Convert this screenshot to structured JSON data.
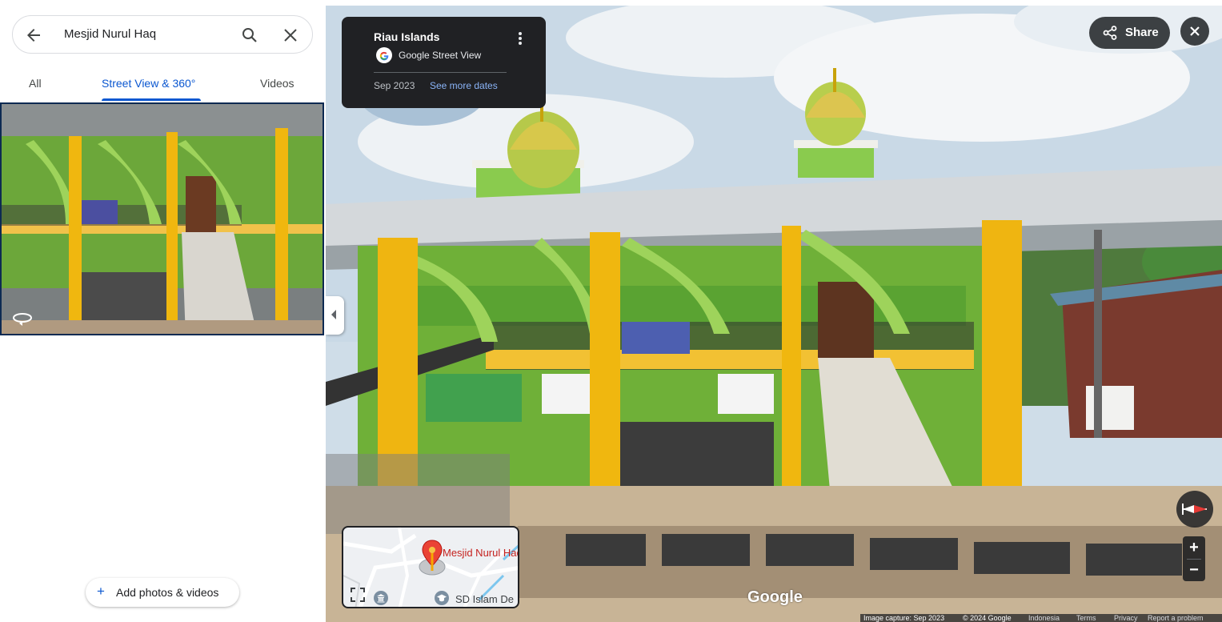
{
  "search": {
    "query": "Mesjid Nurul Haq"
  },
  "icons": {
    "back": "arrow-back-icon",
    "search": "search-icon",
    "clear": "close-icon",
    "rotate360": "rotate-360-icon",
    "google": "google-g-icon",
    "more": "more-vert-icon",
    "share": "share-icon",
    "close_viewer": "close-icon",
    "collapse": "chevron-left-icon",
    "compass": "compass-icon",
    "expand": "fullscreen-icon",
    "museum": "museum-icon",
    "school": "school-icon",
    "pin": "map-pin-icon"
  },
  "tabs": [
    {
      "label": "All",
      "active": false
    },
    {
      "label": "Street View & 360°",
      "active": true
    },
    {
      "label": "Videos",
      "active": false
    }
  ],
  "left_panel": {
    "add_photos_label": "Add photos & videos"
  },
  "info_card": {
    "title": "Riau Islands",
    "source": "Google Street View",
    "date": "Sep 2023",
    "see_more": "See more dates"
  },
  "viewer": {
    "share_label": "Share",
    "zoom_in": "+",
    "zoom_out": "−",
    "watermark": "Google"
  },
  "minimap": {
    "place_label": "Mesjid Nurul Haq",
    "school_label": "SD Islam De"
  },
  "footer": {
    "capture": "Image capture: Sep 2023",
    "copyright": "© 2024 Google",
    "links": [
      "Indonesia",
      "Terms",
      "Privacy",
      "Report a problem"
    ]
  },
  "colors": {
    "accent": "#0b57d0",
    "dark_panel": "#202124",
    "mosque_green": "#7cbd3c",
    "pillar_yellow": "#f2b90f"
  }
}
